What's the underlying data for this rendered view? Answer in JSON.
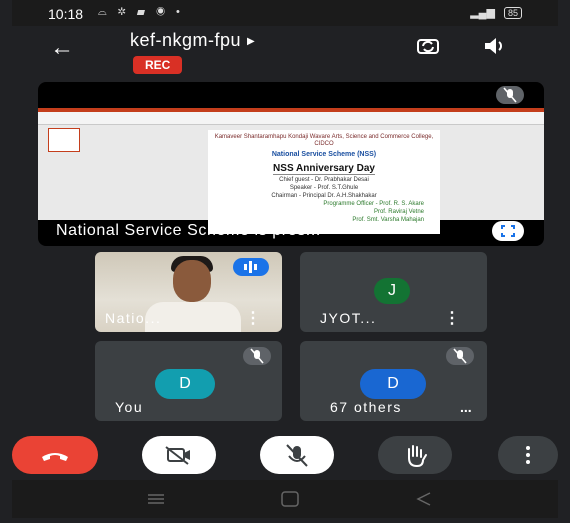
{
  "status": {
    "time": "10:18",
    "battery": "85"
  },
  "meeting": {
    "code": "kef-nkgm-fpu",
    "rec_label": "REC"
  },
  "presentation": {
    "caption": "National Service Scheme is pres...",
    "slide": {
      "org_line": "Kamaveer Shantaramhapu Kondaji Wavare Arts, Science and Commerce College, CIDCO",
      "nss_label": "National Service Scheme (NSS)",
      "event_title": "NSS Anniversary Day",
      "chief_guest": "Chief guest - Dr. Prabhakar Desai",
      "speaker": "Speaker - Prof. S.T.Ghule",
      "chairman": "Chairman - Principal Dr. A.H.Shakhakar",
      "programme_officer": "Programme Officer - Prof. R. S. Akare",
      "officer2": "Prof. Raviraj Vetne",
      "officer3": "Prof. Smt. Varsha Mahajan"
    }
  },
  "participants": [
    {
      "name": "Natio...",
      "avatar_letter": ""
    },
    {
      "name": "JYOT...",
      "avatar_letter": "J",
      "avatar_color": "#137333"
    },
    {
      "name": "You",
      "avatar_letter": "D",
      "avatar_color": "#129eaf"
    },
    {
      "name": "67 others",
      "avatar_letter": "D",
      "avatar_color": "#1967d2"
    }
  ],
  "colors": {
    "end_call": "#ea4335",
    "rec": "#d93025",
    "speaking": "#1a73e8"
  }
}
